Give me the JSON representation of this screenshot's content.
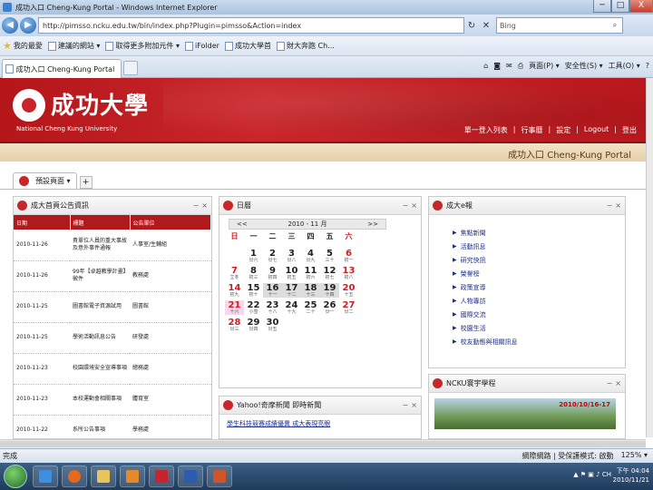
{
  "window": {
    "title": "成功入口 Cheng-Kung Portal - Windows Internet Explorer",
    "minimize": "─",
    "maximize": "□",
    "close": "X"
  },
  "address": {
    "back": "◀",
    "forward": "▶",
    "url": "http://pimsso.ncku.edu.tw/bin/index.php?Plugin=pimsso&Action=index",
    "search_placeholder": "Bing",
    "refresh_glyph": "↻",
    "stop_glyph": "✕"
  },
  "favorites": {
    "label": "我的最愛",
    "items": [
      "建議的網站 ▾",
      "取得更多附加元件 ▾",
      "iFolder",
      "成功大學首",
      "財大奔跑 Ch..."
    ]
  },
  "browser_tab": {
    "label": "成功入口 Cheng-Kung Portal"
  },
  "command_bar": {
    "items": [
      "頁面(P) ▾",
      "安全性(S) ▾",
      "工具(O) ▾",
      "?"
    ]
  },
  "banner": {
    "logo_text": "成功大學",
    "logo_en": "National Cheng Kung University",
    "links": [
      "單一登入列表",
      "行事曆",
      "設定",
      "Logout",
      "登出"
    ]
  },
  "subbar": {
    "portal_name": "成功入口  Cheng-Kung Portal"
  },
  "page_tabs": {
    "default_tab": "預設頁面 ▾",
    "add": "+"
  },
  "announcements": {
    "title": "成大首頁公告資訊",
    "columns": [
      "日期",
      "標題",
      "公告單位"
    ],
    "rows": [
      {
        "date": "2010-11-26",
        "title": "貴單位人員的重大事故及意外事件通報",
        "unit": "人事室/生輔組"
      },
      {
        "date": "2010-11-26",
        "title": "99年【卓越教學計畫】徵件",
        "unit": "教務處"
      },
      {
        "date": "2010-11-25",
        "title": "圖書館電子資源試用",
        "unit": "圖書館"
      },
      {
        "date": "2010-11-25",
        "title": "學術活動訊息公告",
        "unit": "研發處"
      },
      {
        "date": "2010-11-23",
        "title": "校園環境安全宣導事項",
        "unit": "總務處"
      },
      {
        "date": "2010-11-23",
        "title": "本校運動會相關事項",
        "unit": "體育室"
      },
      {
        "date": "2010-11-22",
        "title": "系所公告事項",
        "unit": "學務處"
      }
    ]
  },
  "calendar": {
    "title": "日曆",
    "month_label": "2010 - 11 月",
    "prev": "<<",
    "next": ">>",
    "weekdays": [
      "日",
      "一",
      "二",
      "三",
      "四",
      "五",
      "六"
    ],
    "days": [
      {
        "d": "",
        "s": ""
      },
      {
        "d": "1",
        "s": "廿六"
      },
      {
        "d": "2",
        "s": "廿七"
      },
      {
        "d": "3",
        "s": "廿八"
      },
      {
        "d": "4",
        "s": "廿九"
      },
      {
        "d": "5",
        "s": "三十"
      },
      {
        "d": "6",
        "s": "初一"
      },
      {
        "d": "7",
        "s": "立冬"
      },
      {
        "d": "8",
        "s": "初三"
      },
      {
        "d": "9",
        "s": "初四"
      },
      {
        "d": "10",
        "s": "初五"
      },
      {
        "d": "11",
        "s": "初六"
      },
      {
        "d": "12",
        "s": "初七"
      },
      {
        "d": "13",
        "s": "初八"
      },
      {
        "d": "14",
        "s": "初九"
      },
      {
        "d": "15",
        "s": "初十"
      },
      {
        "d": "16",
        "s": "十一"
      },
      {
        "d": "17",
        "s": "十二"
      },
      {
        "d": "18",
        "s": "十三"
      },
      {
        "d": "19",
        "s": "十四"
      },
      {
        "d": "20",
        "s": "十五"
      },
      {
        "d": "21",
        "s": "十六"
      },
      {
        "d": "22",
        "s": "小雪"
      },
      {
        "d": "23",
        "s": "十八"
      },
      {
        "d": "24",
        "s": "十九"
      },
      {
        "d": "25",
        "s": "二十"
      },
      {
        "d": "26",
        "s": "廿一"
      },
      {
        "d": "27",
        "s": "廿二"
      },
      {
        "d": "28",
        "s": "廿三"
      },
      {
        "d": "29",
        "s": "廿四"
      },
      {
        "d": "30",
        "s": "廿五"
      },
      {
        "d": "",
        "s": ""
      },
      {
        "d": "",
        "s": ""
      },
      {
        "d": "",
        "s": ""
      },
      {
        "d": "",
        "s": ""
      }
    ]
  },
  "news": {
    "title": "成大e報",
    "items": [
      "焦點新聞",
      "活動訊息",
      "研究快訊",
      "榮譽榜",
      "政策宣導",
      "人物專訪",
      "國際交流",
      "校園生活",
      "校友動態與相關訊息"
    ]
  },
  "yahoo": {
    "title": "Yahoo!奇摩新聞 即時新聞",
    "link": "學生科技競賽成績優異 成大表現亮眼"
  },
  "promo": {
    "title": "NCKU寰宇學程",
    "banner_text": "2010/10/16-17"
  },
  "status": {
    "left": "完成",
    "zone": "網際網路 | 受保護模式: 啟動",
    "zoom": "125% ▾"
  },
  "taskbar": {
    "time": "下午 04:04",
    "date": "2010/11/21",
    "tray": "▲ ⚑ ▣ ♪ CH"
  }
}
